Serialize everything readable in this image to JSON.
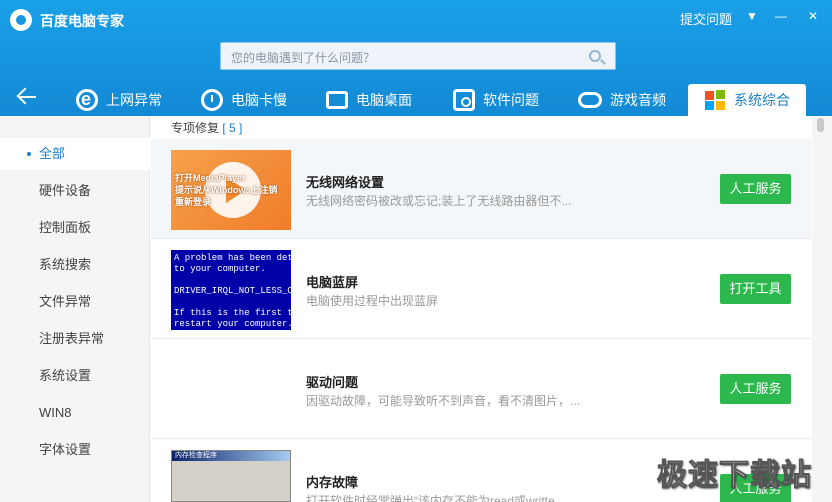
{
  "app": {
    "title": "百度电脑专家",
    "help_label": "提交问题",
    "menu_glyph": "▼",
    "minimize_glyph": "—",
    "close_glyph": "✕"
  },
  "search": {
    "placeholder": "您的电脑遇到了什么问题？"
  },
  "tabs": [
    {
      "label": "上网异常",
      "icon": "ie-icon"
    },
    {
      "label": "电脑卡慢",
      "icon": "clock-icon"
    },
    {
      "label": "电脑桌面",
      "icon": "monitor-icon"
    },
    {
      "label": "软件问题",
      "icon": "software-icon"
    },
    {
      "label": "游戏音频",
      "icon": "gamepad-icon"
    },
    {
      "label": "系统综合",
      "icon": "windows-icon",
      "active": true
    }
  ],
  "sidebar": {
    "items": [
      {
        "label": "全部",
        "active": true
      },
      {
        "label": "硬件设备"
      },
      {
        "label": "控制面板"
      },
      {
        "label": "系统搜索"
      },
      {
        "label": "文件异常"
      },
      {
        "label": "注册表异常"
      },
      {
        "label": "系统设置"
      },
      {
        "label": "WIN8"
      },
      {
        "label": "字体设置"
      }
    ]
  },
  "section": {
    "title": "专项修复",
    "count": "[ 5 ]"
  },
  "items": [
    {
      "title": "无线网络设置",
      "desc": "无线网络密码被改或忘记;装上了无线路由器但不...",
      "button": "人工服务",
      "thumb_caption": "打开MediaPlayer\n提示说从Windows上注销\n重新登录"
    },
    {
      "title": "电脑蓝屏",
      "desc": "电脑使用过程中出现蓝屏",
      "button": "打开工具",
      "thumb_text": "A problem has been dete\nto your computer.\n\nDRIVER_IRQL_NOT_LESS_OR\n\nIf this is the first ti\nrestart your computer.\nthese steps:"
    },
    {
      "title": "驱动问题",
      "desc": "因驱动故障，可能导致听不到声音，看不清图片，...",
      "button": "人工服务"
    },
    {
      "title": "内存故障",
      "desc": "打开软件时经常弹出“该内存不能为read或writte",
      "button": "人工服务",
      "thumb_bar": "内存检查程序"
    }
  ],
  "watermark": "极速下载站",
  "colors": {
    "header": "#1aa0e8",
    "accent": "#1a7fc8",
    "button": "#2db84d"
  }
}
